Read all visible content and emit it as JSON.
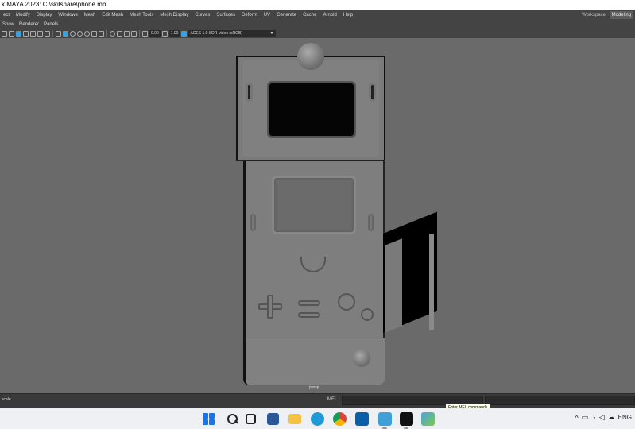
{
  "window": {
    "title": "k MAYA 2023: C:\\skilshare\\phone.mb"
  },
  "menubar": {
    "items": [
      "ect",
      "Modify",
      "Display",
      "Windows",
      "Mesh",
      "Edit Mesh",
      "Mesh Tools",
      "Mesh Display",
      "Curves",
      "Surfaces",
      "Deform",
      "UV",
      "Generate",
      "Cache",
      "Arnold",
      "Help"
    ],
    "workspace_label": "Workspace:",
    "workspace_value": "Modeling"
  },
  "panel_menu": {
    "items": [
      "Show",
      "Renderer",
      "Panels"
    ]
  },
  "view_toolbar": {
    "exposure": "0.00",
    "gamma": "1.00",
    "color_management": "ACES 1.0 SDR-video (sRGB)"
  },
  "viewport": {
    "camera_label": "persp"
  },
  "help_line": {
    "text": "scale"
  },
  "command_line": {
    "language": "MEL",
    "tooltip": "Enter MEL commands"
  },
  "taskbar": {
    "apps": [
      "start-icon",
      "search-icon",
      "task-view-icon",
      "widgets-icon",
      "file-explorer-icon",
      "edge-icon",
      "chrome-icon",
      "store-icon",
      "maya-icon",
      "app-icon",
      "photos-icon"
    ],
    "tray": {
      "language": "ENG"
    }
  },
  "colors": {
    "viewport_bg": "#6a6a6a",
    "maya_ui": "#444444",
    "accent": "#3fa0d8"
  }
}
